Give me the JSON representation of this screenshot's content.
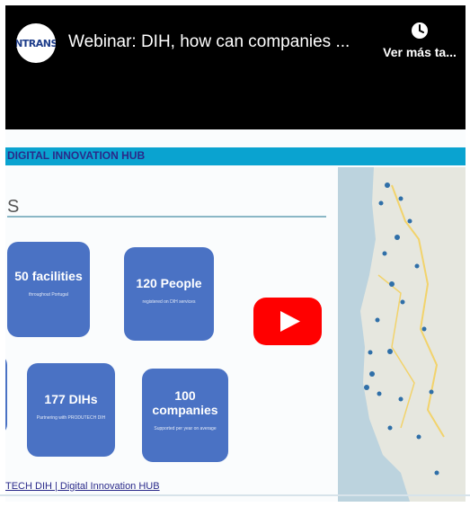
{
  "header": {
    "channel_logo_text": "NTRANS",
    "title": "Webinar: DIH, how can companies ...",
    "watch_later_label": "Ver más ta..."
  },
  "slide": {
    "hub_label": "DIGITAL INNOVATION HUB",
    "section_fragment": "S",
    "cards": [
      {
        "title": "50 facilities",
        "subtitle": "throughout Portugal"
      },
      {
        "title": "120 People",
        "subtitle": "registered on DIH services"
      },
      {
        "title": "177 DIHs",
        "subtitle": "Partnering with PRODUTECH DIH"
      },
      {
        "title": "100 companies",
        "subtitle": "Supported per year on average"
      }
    ],
    "footer": "TECH DIH | Digital Innovation HUB"
  },
  "colors": {
    "accent_cyan": "#0aa3d0",
    "card_blue": "#4a72c4",
    "youtube_red": "#ff0000"
  },
  "icons": {
    "play": "youtube-play-icon",
    "watch_later": "clock-icon"
  }
}
